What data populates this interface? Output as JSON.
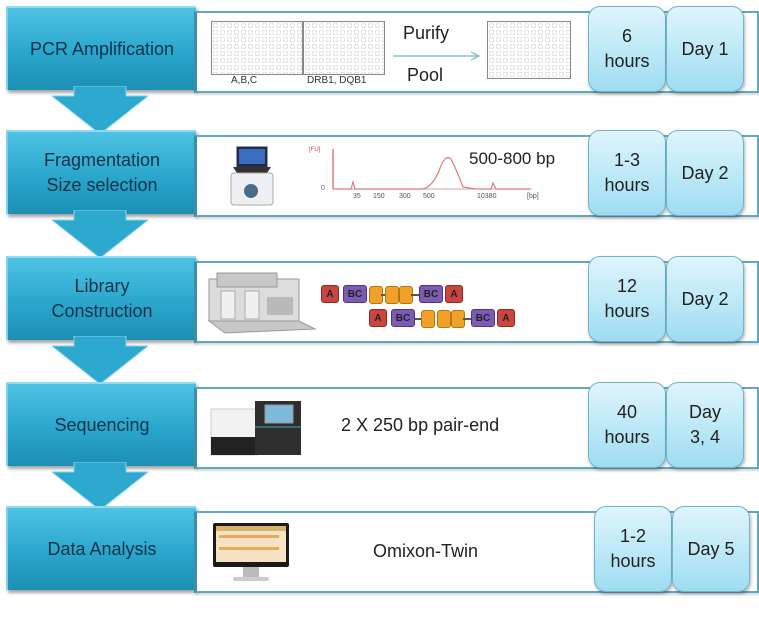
{
  "steps": [
    {
      "label": "PCR Amplification",
      "duration": "6\nhours",
      "day": "Day 1",
      "content": {
        "plate_labels": [
          "A,B,C",
          "DRB1,  DQB1"
        ],
        "arrow_top_label": "Purify",
        "arrow_bottom_label": "Pool"
      }
    },
    {
      "label": "Fragmentation\nSize selection",
      "duration": "1-3\nhours",
      "day": "Day 2",
      "content": {
        "size_range": "500-800 bp",
        "trace": {
          "y_label": "[FU]",
          "y_zero": "0",
          "x_unit": "[bp]",
          "x_ticks": [
            "35",
            "150",
            "300",
            "500",
            "10380"
          ]
        }
      }
    },
    {
      "label": "Library\nConstruction",
      "duration": "12\nhours",
      "day": "Day 2",
      "content": {
        "adapter_label": "A",
        "barcode_label": "BC"
      }
    },
    {
      "label": "Sequencing",
      "duration": "40\nhours",
      "day": "Day\n3, 4",
      "content": {
        "description": "2 X 250 bp pair-end"
      }
    },
    {
      "label": "Data Analysis",
      "duration": "1-2\nhours",
      "day": "Day 5",
      "content": {
        "description": "Omixon-Twin"
      }
    }
  ],
  "colors": {
    "step_box": "#2aa6cc",
    "pill": "#b8e7f6",
    "content_border": "#5fa8bd",
    "adapter": "#c9463e",
    "barcode": "#7d5bb5",
    "insert": "#f0a228",
    "trace": "#e07a7a"
  }
}
